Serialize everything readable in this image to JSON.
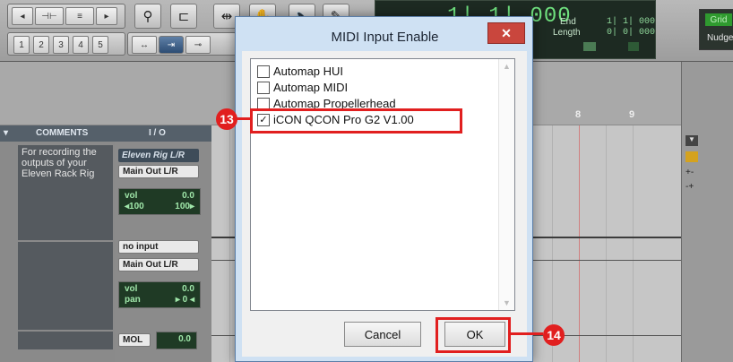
{
  "toolbar": {
    "track_numbers": [
      "1",
      "2",
      "3",
      "4",
      "5"
    ],
    "counter": {
      "main": "1| 1| 000",
      "labels": [
        "End",
        "Length"
      ],
      "values": [
        "1| 1| 000",
        "0| 0| 000"
      ]
    },
    "grid_label": "Grid",
    "nudge_label": "Nudge"
  },
  "tracks": {
    "headers": [
      "COMMENTS",
      "I / O"
    ],
    "track1": {
      "comment": "For recording the outputs of your Eleven Rack Rig",
      "input": "Eleven Rig L/R",
      "output": "Main Out L/R",
      "vol_label": "vol",
      "vol_value": "0.0",
      "pan_left": "◂100",
      "pan_right": "100▸"
    },
    "track2": {
      "input": "no input",
      "output": "Main Out L/R",
      "vol_label": "vol",
      "vol_value": "0.0",
      "pan_label": "pan",
      "pan_value": "▸ 0 ◂"
    },
    "track3": {
      "label": "MOL",
      "value": "0.0"
    },
    "ruler_marks": [
      "8",
      "9"
    ]
  },
  "dialog": {
    "title": "MIDI Input Enable",
    "close_glyph": "✕",
    "items": [
      {
        "label": "Automap HUI",
        "checked": false
      },
      {
        "label": "Automap MIDI",
        "checked": false
      },
      {
        "label": "Automap Propellerhead",
        "checked": false
      },
      {
        "label": "iCON QCON Pro G2 V1.00",
        "checked": true
      }
    ],
    "check_glyph": "✓",
    "cancel_label": "Cancel",
    "ok_label": "OK"
  },
  "annotations": {
    "step13": "13",
    "step14": "14",
    "color": "#e11f1f"
  }
}
